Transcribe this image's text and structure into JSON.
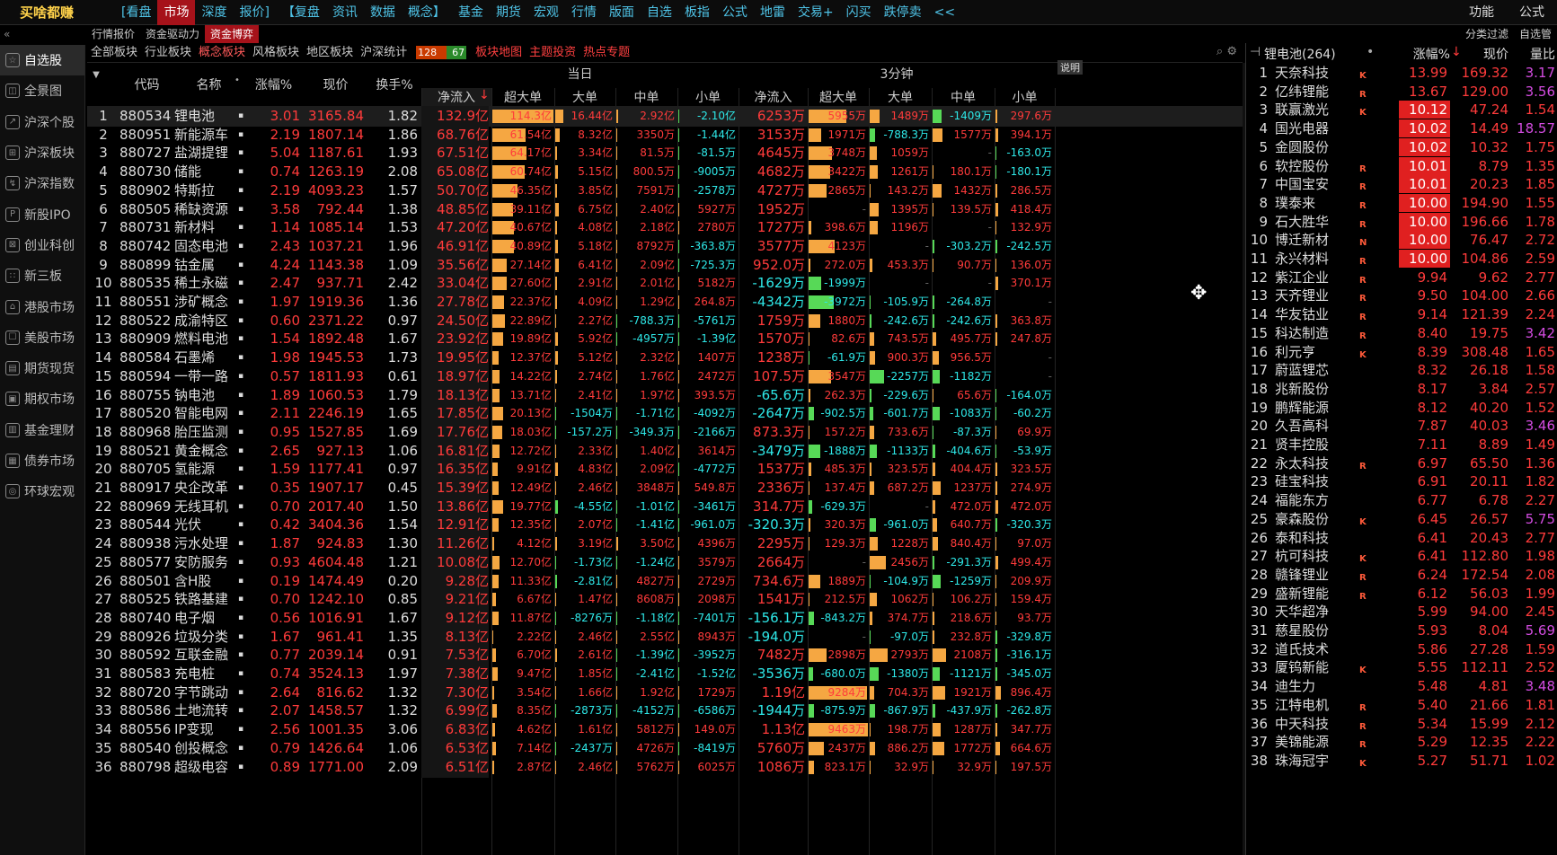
{
  "app": {
    "brand": "买啥都赚",
    "apple_icon": "apple-icon"
  },
  "topnav": [
    "[看盘",
    "市场",
    "深度",
    "报价]",
    "【复盘",
    "资讯",
    "数据",
    "概念】",
    "基金",
    "期货",
    "宏观",
    "行情",
    "版面",
    "自选",
    "板指",
    "公式",
    "地雷",
    "交易+",
    "闪买",
    "跌停卖",
    "<<"
  ],
  "topnav_active": "市场",
  "top_right": [
    "功能",
    "公式"
  ],
  "second_tabs": [
    "行情报价",
    "资金驱动力",
    "资金博弈"
  ],
  "second_active": "资金博弈",
  "second_right": [
    "分类过滤",
    "自选管"
  ],
  "collapse_glyph": "«",
  "sidebar": [
    "自选股",
    "全景图",
    "沪深个股",
    "沪深板块",
    "沪深指数",
    "新股IPO",
    "创业科创",
    "新三板",
    "港股市场",
    "美股市场",
    "期货现货",
    "期权市场",
    "基金理财",
    "债券市场",
    "环球宏观"
  ],
  "third_tabs": [
    "全部板块",
    "行业板块",
    "概念板块",
    "风格板块",
    "地区板块",
    "沪深统计"
  ],
  "third_active": "概念板块",
  "mini_bar": {
    "red": "128",
    "green": "67"
  },
  "third_links": [
    "板块地图",
    "主题投资",
    "热点专题"
  ],
  "table": {
    "hdr_group_today": "当日",
    "hdr_group_3min": "3分钟",
    "explain": "说明",
    "cols": [
      "代码",
      "名称",
      "涨幅%",
      "现价",
      "换手%"
    ],
    "sub_cols": [
      "净流入",
      "超大单",
      "大单",
      "中单",
      "小单",
      "净流入",
      "超大单",
      "大单",
      "中单",
      "小单"
    ],
    "sort_arrow": "↓",
    "rows": [
      [
        "1",
        "880534",
        "锂电池",
        "3.01",
        "3165.84",
        "1.82",
        "132.9亿",
        "114.3亿",
        "16.44亿",
        "2.92亿",
        "-2.10亿",
        "6253万",
        "5955万",
        "1489万",
        "-1409万",
        "297.6万"
      ],
      [
        "2",
        "880951",
        "新能源车",
        "2.19",
        "1807.14",
        "1.86",
        "68.76亿",
        "61.54亿",
        "8.32亿",
        "3350万",
        "-1.44亿",
        "3153万",
        "1971万",
        "-788.3万",
        "1577万",
        "394.1万"
      ],
      [
        "3",
        "880727",
        "盐湖提锂",
        "5.04",
        "1187.61",
        "1.93",
        "67.51亿",
        "64.17亿",
        "3.34亿",
        "81.5万",
        "-81.5万",
        "4645万",
        "3748万",
        "1059万",
        "-",
        "-163.0万"
      ],
      [
        "4",
        "880730",
        "储能",
        "0.74",
        "1263.19",
        "2.08",
        "65.08亿",
        "60.74亿",
        "5.15亿",
        "800.5万",
        "-9005万",
        "4682万",
        "3422万",
        "1261万",
        "180.1万",
        "-180.1万"
      ],
      [
        "5",
        "880902",
        "特斯拉",
        "2.19",
        "4093.23",
        "1.57",
        "50.70亿",
        "46.35亿",
        "3.85亿",
        "7591万",
        "-2578万",
        "4727万",
        "2865万",
        "143.2万",
        "1432万",
        "286.5万"
      ],
      [
        "6",
        "880505",
        "稀缺资源",
        "3.58",
        "792.44",
        "1.38",
        "48.85亿",
        "39.11亿",
        "6.75亿",
        "2.40亿",
        "5927万",
        "1952万",
        "-",
        "1395万",
        "139.5万",
        "418.4万"
      ],
      [
        "7",
        "880731",
        "新材料",
        "1.14",
        "1085.14",
        "1.53",
        "47.20亿",
        "40.67亿",
        "4.08亿",
        "2.18亿",
        "2780万",
        "1727万",
        "398.6万",
        "1196万",
        "-",
        "132.9万"
      ],
      [
        "8",
        "880742",
        "固态电池",
        "2.43",
        "1037.21",
        "1.96",
        "46.91亿",
        "40.89亿",
        "5.18亿",
        "8792万",
        "-363.8万",
        "3577万",
        "4123万",
        "-",
        "-303.2万",
        "-242.5万"
      ],
      [
        "9",
        "880899",
        "钴金属",
        "4.24",
        "1143.38",
        "1.09",
        "35.56亿",
        "27.14亿",
        "6.41亿",
        "2.09亿",
        "-725.3万",
        "952.0万",
        "272.0万",
        "453.3万",
        "90.7万",
        "136.0万"
      ],
      [
        "10",
        "880535",
        "稀土永磁",
        "2.47",
        "937.71",
        "2.42",
        "33.04亿",
        "27.60亿",
        "2.91亿",
        "2.01亿",
        "5182万",
        "-1629万",
        "-1999万",
        "-",
        "-",
        "370.1万"
      ],
      [
        "11",
        "880551",
        "涉矿概念",
        "1.97",
        "1919.36",
        "1.36",
        "27.78亿",
        "22.37亿",
        "4.09亿",
        "1.29亿",
        "264.8万",
        "-4342万",
        "-3972万",
        "-105.9万",
        "-264.8万",
        "-"
      ],
      [
        "12",
        "880522",
        "成渝特区",
        "0.60",
        "2371.22",
        "0.97",
        "24.50亿",
        "22.89亿",
        "2.27亿",
        "-788.3万",
        "-5761万",
        "1759万",
        "1880万",
        "-242.6万",
        "-242.6万",
        "363.8万"
      ],
      [
        "13",
        "880909",
        "燃料电池",
        "1.54",
        "1892.48",
        "1.67",
        "23.92亿",
        "19.89亿",
        "5.92亿",
        "-4957万",
        "-1.39亿",
        "1570万",
        "82.6万",
        "743.5万",
        "495.7万",
        "247.8万"
      ],
      [
        "14",
        "880584",
        "石墨烯",
        "1.98",
        "1945.53",
        "1.73",
        "19.95亿",
        "12.37亿",
        "5.12亿",
        "2.32亿",
        "1407万",
        "1238万",
        "-61.9万",
        "900.3万",
        "956.5万",
        "-"
      ],
      [
        "15",
        "880594",
        "一带一路",
        "0.57",
        "1811.93",
        "0.61",
        "18.97亿",
        "14.22亿",
        "2.74亿",
        "1.76亿",
        "2472万",
        "107.5万",
        "3547万",
        "-2257万",
        "-1182万",
        "-"
      ],
      [
        "16",
        "880755",
        "钠电池",
        "1.89",
        "1060.53",
        "1.79",
        "18.13亿",
        "13.71亿",
        "2.41亿",
        "1.97亿",
        "393.5万",
        "-65.6万",
        "262.3万",
        "-229.6万",
        "65.6万",
        "-164.0万"
      ],
      [
        "17",
        "880520",
        "智能电网",
        "2.11",
        "2246.19",
        "1.65",
        "17.85亿",
        "20.13亿",
        "-1504万",
        "-1.71亿",
        "-4092万",
        "-2647万",
        "-902.5万",
        "-601.7万",
        "-1083万",
        "-60.2万"
      ],
      [
        "18",
        "880968",
        "胎压监测",
        "0.95",
        "1527.85",
        "1.69",
        "17.76亿",
        "18.03亿",
        "-157.2万",
        "-349.3万",
        "-2166万",
        "873.3万",
        "157.2万",
        "733.6万",
        "-87.3万",
        "69.9万"
      ],
      [
        "19",
        "880521",
        "黄金概念",
        "2.65",
        "927.13",
        "1.06",
        "16.81亿",
        "12.72亿",
        "2.33亿",
        "1.40亿",
        "3614万",
        "-3479万",
        "-1888万",
        "-1133万",
        "-404.6万",
        "-53.9万"
      ],
      [
        "20",
        "880705",
        "氢能源",
        "1.59",
        "1177.41",
        "0.97",
        "16.35亿",
        "9.91亿",
        "4.83亿",
        "2.09亿",
        "-4772万",
        "1537万",
        "485.3万",
        "323.5万",
        "404.4万",
        "323.5万"
      ],
      [
        "21",
        "880917",
        "央企改革",
        "0.35",
        "1907.17",
        "0.45",
        "15.39亿",
        "12.49亿",
        "2.46亿",
        "3848万",
        "549.8万",
        "2336万",
        "137.4万",
        "687.2万",
        "1237万",
        "274.9万"
      ],
      [
        "22",
        "880969",
        "无线耳机",
        "0.70",
        "2017.40",
        "1.50",
        "13.86亿",
        "19.77亿",
        "-4.55亿",
        "-1.01亿",
        "-3461万",
        "314.7万",
        "-629.3万",
        "-",
        "472.0万",
        "472.0万"
      ],
      [
        "23",
        "880544",
        "光伏",
        "0.42",
        "3404.36",
        "1.54",
        "12.91亿",
        "12.35亿",
        "2.07亿",
        "-1.41亿",
        "-961.0万",
        "-320.3万",
        "320.3万",
        "-961.0万",
        "640.7万",
        "-320.3万"
      ],
      [
        "24",
        "880938",
        "污水处理",
        "1.87",
        "924.83",
        "1.30",
        "11.26亿",
        "4.12亿",
        "3.19亿",
        "3.50亿",
        "4396万",
        "2295万",
        "129.3万",
        "1228万",
        "840.4万",
        "97.0万"
      ],
      [
        "25",
        "880577",
        "安防服务",
        "0.93",
        "4604.48",
        "1.21",
        "10.08亿",
        "12.70亿",
        "-1.73亿",
        "-1.24亿",
        "3579万",
        "2664万",
        "-",
        "2456万",
        "-291.3万",
        "499.4万"
      ],
      [
        "26",
        "880501",
        "含H股",
        "0.19",
        "1474.49",
        "0.20",
        "9.28亿",
        "11.33亿",
        "-2.81亿",
        "4827万",
        "2729万",
        "734.6万",
        "1889万",
        "-104.9万",
        "-1259万",
        "209.9万"
      ],
      [
        "27",
        "880525",
        "铁路基建",
        "0.70",
        "1242.10",
        "0.85",
        "9.21亿",
        "6.67亿",
        "1.47亿",
        "8608万",
        "2098万",
        "1541万",
        "212.5万",
        "1062万",
        "106.2万",
        "159.4万"
      ],
      [
        "28",
        "880740",
        "电子烟",
        "0.56",
        "1016.91",
        "1.67",
        "9.12亿",
        "11.87亿",
        "-8276万",
        "-1.18亿",
        "-7401万",
        "-156.1万",
        "-843.2万",
        "374.7万",
        "218.6万",
        "93.7万"
      ],
      [
        "29",
        "880926",
        "垃圾分类",
        "1.67",
        "961.41",
        "1.35",
        "8.13亿",
        "2.22亿",
        "2.46亿",
        "2.55亿",
        "8943万",
        "-194.0万",
        "-",
        "-97.0万",
        "232.8万",
        "-329.8万"
      ],
      [
        "30",
        "880592",
        "互联金融",
        "0.77",
        "2039.14",
        "0.91",
        "7.53亿",
        "6.70亿",
        "2.61亿",
        "-1.39亿",
        "-3952万",
        "7482万",
        "2898万",
        "2793万",
        "2108万",
        "-316.1万"
      ],
      [
        "31",
        "880583",
        "充电桩",
        "0.74",
        "3524.13",
        "1.97",
        "7.38亿",
        "9.47亿",
        "1.85亿",
        "-2.41亿",
        "-1.52亿",
        "-3536万",
        "-680.0万",
        "-1380万",
        "-1121万",
        "-345.0万"
      ],
      [
        "32",
        "880720",
        "字节跳动",
        "2.64",
        "816.62",
        "1.32",
        "7.30亿",
        "3.54亿",
        "1.66亿",
        "1.92亿",
        "1729万",
        "1.19亿",
        "9284万",
        "704.3万",
        "1921万",
        "896.4万"
      ],
      [
        "33",
        "880586",
        "土地流转",
        "2.07",
        "1458.57",
        "1.32",
        "6.99亿",
        "8.35亿",
        "-2873万",
        "-4152万",
        "-6586万",
        "-1944万",
        "-875.9万",
        "-867.9万",
        "-437.9万",
        "-262.8万"
      ],
      [
        "34",
        "880556",
        "IP变现",
        "2.56",
        "1001.35",
        "3.06",
        "6.83亿",
        "4.62亿",
        "1.61亿",
        "5812万",
        "149.0万",
        "1.13亿",
        "9463万",
        "198.7万",
        "1287万",
        "347.7万"
      ],
      [
        "35",
        "880540",
        "创投概念",
        "0.79",
        "1426.64",
        "1.06",
        "6.53亿",
        "7.14亿",
        "-2437万",
        "4726万",
        "-8419万",
        "5760万",
        "2437万",
        "886.2万",
        "1772万",
        "664.6万"
      ],
      [
        "36",
        "880798",
        "超级电容",
        "0.89",
        "1771.00",
        "2.09",
        "6.51亿",
        "2.87亿",
        "2.46亿",
        "5762万",
        "6025万",
        "1086万",
        "823.1万",
        "32.9万",
        "32.9万",
        "197.5万"
      ]
    ]
  },
  "right_panel": {
    "title": "锂电池(264)",
    "cols": [
      "涨幅%",
      "现价",
      "量比"
    ],
    "rows": [
      [
        "1",
        "天奈科技",
        "K",
        "13.99",
        "169.32",
        "3.17"
      ],
      [
        "2",
        "亿纬锂能",
        "R",
        "13.67",
        "129.00",
        "3.56"
      ],
      [
        "3",
        "联赢激光",
        "K",
        "10.12",
        "47.24",
        "1.54"
      ],
      [
        "4",
        "国光电器",
        "",
        "10.02",
        "14.49",
        "18.57"
      ],
      [
        "5",
        "金圆股份",
        "",
        "10.02",
        "10.32",
        "1.75"
      ],
      [
        "6",
        "软控股份",
        "R",
        "10.01",
        "8.79",
        "1.35"
      ],
      [
        "7",
        "中国宝安",
        "R",
        "10.01",
        "20.23",
        "1.85"
      ],
      [
        "8",
        "璞泰来",
        "R",
        "10.00",
        "194.90",
        "1.55"
      ],
      [
        "9",
        "石大胜华",
        "R",
        "10.00",
        "196.66",
        "1.78"
      ],
      [
        "10",
        "博迁新材",
        "N",
        "10.00",
        "76.47",
        "2.72"
      ],
      [
        "11",
        "永兴材料",
        "R",
        "10.00",
        "104.86",
        "2.59"
      ],
      [
        "12",
        "紫江企业",
        "R",
        "9.94",
        "9.62",
        "2.77"
      ],
      [
        "13",
        "天齐锂业",
        "R",
        "9.50",
        "104.00",
        "2.66"
      ],
      [
        "14",
        "华友钴业",
        "R",
        "9.14",
        "121.39",
        "2.24"
      ],
      [
        "15",
        "科达制造",
        "R",
        "8.40",
        "19.75",
        "3.42"
      ],
      [
        "16",
        "利元亨",
        "K",
        "8.39",
        "308.48",
        "1.65"
      ],
      [
        "17",
        "蔚蓝锂芯",
        "",
        "8.32",
        "26.18",
        "1.58"
      ],
      [
        "18",
        "兆新股份",
        "",
        "8.17",
        "3.84",
        "2.57"
      ],
      [
        "19",
        "鹏辉能源",
        "",
        "8.12",
        "40.20",
        "1.52"
      ],
      [
        "20",
        "久吾高科",
        "",
        "7.87",
        "40.03",
        "3.46"
      ],
      [
        "21",
        "贤丰控股",
        "",
        "7.11",
        "8.89",
        "1.49"
      ],
      [
        "22",
        "永太科技",
        "R",
        "6.97",
        "65.50",
        "1.36"
      ],
      [
        "23",
        "硅宝科技",
        "",
        "6.91",
        "20.11",
        "1.82"
      ],
      [
        "24",
        "福能东方",
        "",
        "6.77",
        "6.78",
        "2.27"
      ],
      [
        "25",
        "豪森股份",
        "K",
        "6.45",
        "26.57",
        "5.75"
      ],
      [
        "26",
        "泰和科技",
        "",
        "6.41",
        "20.43",
        "2.77"
      ],
      [
        "27",
        "杭可科技",
        "K",
        "6.41",
        "112.80",
        "1.98"
      ],
      [
        "28",
        "赣锋锂业",
        "R",
        "6.24",
        "172.54",
        "2.08"
      ],
      [
        "29",
        "盛新锂能",
        "R",
        "6.12",
        "56.03",
        "1.99"
      ],
      [
        "30",
        "天华超净",
        "",
        "5.99",
        "94.00",
        "2.45"
      ],
      [
        "31",
        "慈星股份",
        "",
        "5.93",
        "8.04",
        "5.69"
      ],
      [
        "32",
        "道氏技术",
        "",
        "5.86",
        "27.28",
        "1.59"
      ],
      [
        "33",
        "厦钨新能",
        "K",
        "5.55",
        "112.11",
        "2.52"
      ],
      [
        "34",
        "迪生力",
        "",
        "5.48",
        "4.81",
        "3.48"
      ],
      [
        "35",
        "江特电机",
        "R",
        "5.40",
        "21.66",
        "1.81"
      ],
      [
        "36",
        "中天科技",
        "R",
        "5.34",
        "15.99",
        "2.12"
      ],
      [
        "37",
        "美锦能源",
        "R",
        "5.29",
        "12.35",
        "2.22"
      ],
      [
        "38",
        "珠海冠宇",
        "K",
        "5.27",
        "51.71",
        "1.02"
      ]
    ]
  },
  "colors": {
    "up": "#ff3b3b",
    "down": "#2ee8e8",
    "orange_bar": "#f5a742",
    "green_bar": "#57d957",
    "limit_bg": "#e02020",
    "active_tab": "#a6121a"
  }
}
